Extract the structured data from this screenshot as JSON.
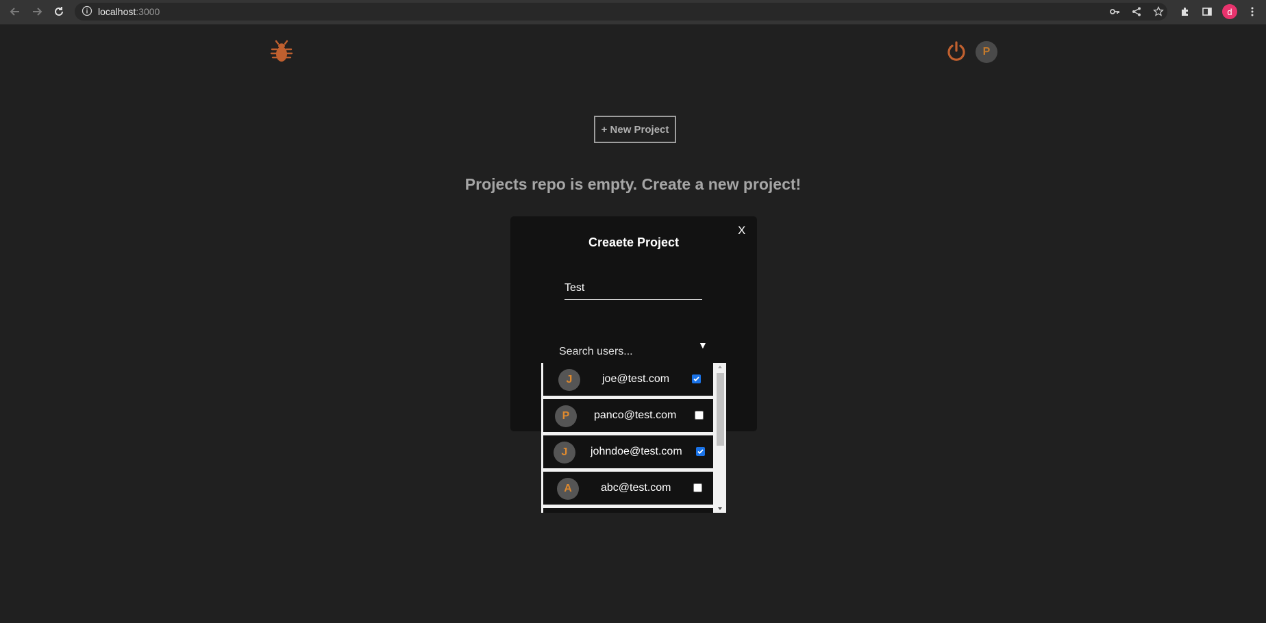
{
  "browser": {
    "url_host": "localhost",
    "url_port": ":3000",
    "profile_initial": "d",
    "profile_color": "#e8336d"
  },
  "header": {
    "logo_icon": "bug-icon",
    "logout_icon": "power-icon",
    "avatar_initial": "P",
    "accent_color": "#c0602f"
  },
  "main": {
    "new_project_label": "+ New Project",
    "empty_message": "Projects repo is empty. Create a new project!"
  },
  "modal": {
    "close_label": "X",
    "title": "Creaete Project",
    "project_name_value": "Test",
    "search_placeholder": "Search users...",
    "dropdown_arrow": "▼",
    "users": [
      {
        "initial": "J",
        "email": "joe@test.com",
        "checked": true
      },
      {
        "initial": "P",
        "email": "panco@test.com",
        "checked": false
      },
      {
        "initial": "J",
        "email": "johndoe@test.com",
        "checked": true
      },
      {
        "initial": "A",
        "email": "abc@test.com",
        "checked": false
      }
    ]
  }
}
